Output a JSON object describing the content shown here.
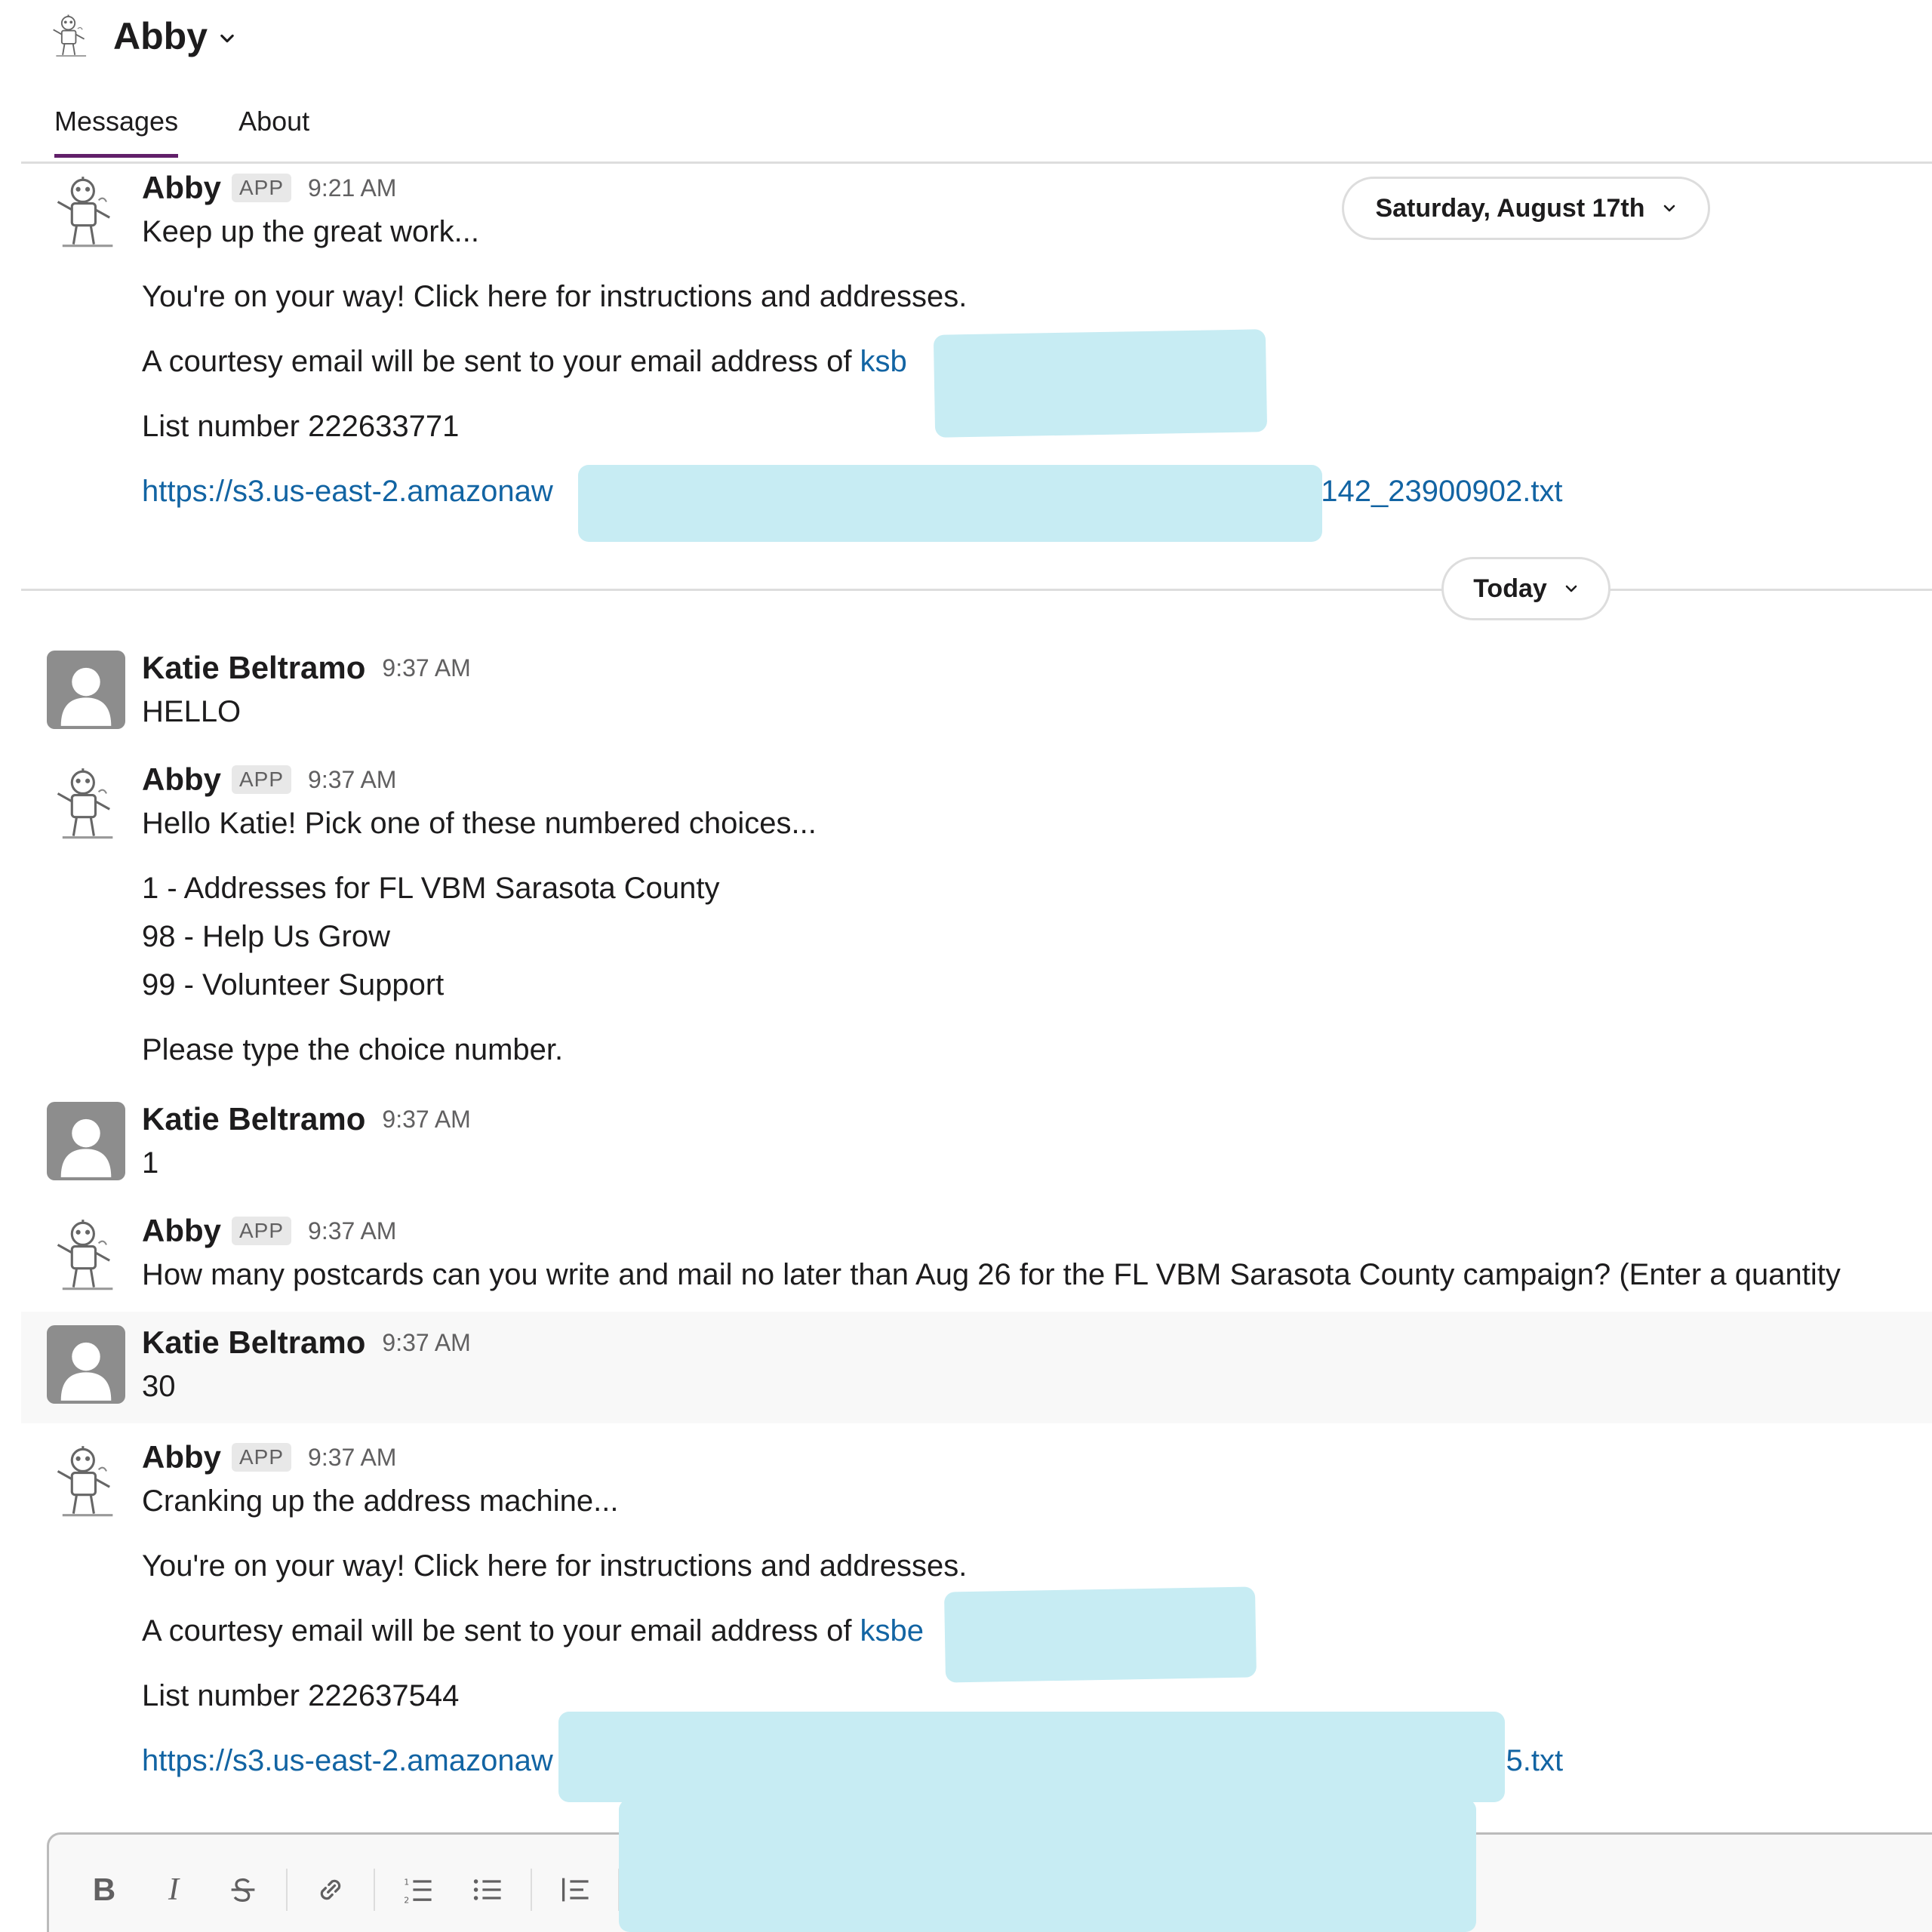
{
  "header": {
    "title": "Abby"
  },
  "tabs": [
    {
      "label": "Messages",
      "active": true
    },
    {
      "label": "About",
      "active": false
    }
  ],
  "date_pills": {
    "first": "Saturday, August 17th",
    "second": "Today"
  },
  "messages": [
    {
      "sender": "Abby",
      "badge": "APP",
      "time": "9:21 AM",
      "lines": [
        "Keep up the great work...",
        "You're on your way! Click here for instructions and addresses.",
        "A courtesy email will be sent to your email address of ",
        "List number 222633771"
      ],
      "email_partial": "ksb",
      "link_start": "https://s3.us-east-2.amazonaw",
      "link_end": "_142_23900902.txt"
    },
    {
      "sender": "Katie Beltramo",
      "time": "9:37 AM",
      "text": "HELLO"
    },
    {
      "sender": "Abby",
      "badge": "APP",
      "time": "9:37 AM",
      "lines": [
        "Hello Katie! Pick one of these numbered choices...",
        "1 - Addresses for FL VBM Sarasota County",
        "98 - Help Us Grow",
        "99 - Volunteer Support",
        "Please type the choice number."
      ]
    },
    {
      "sender": "Katie Beltramo",
      "time": "9:37 AM",
      "text": "1"
    },
    {
      "sender": "Abby",
      "badge": "APP",
      "time": "9:37 AM",
      "text": "How many postcards can you write and mail no later than Aug 26 for the FL VBM Sarasota County campaign? (Enter a quantity"
    },
    {
      "sender": "Katie Beltramo",
      "time": "9:37 AM",
      "text": "30"
    },
    {
      "sender": "Abby",
      "badge": "APP",
      "time": "9:37 AM",
      "lines": [
        "Cranking up the address machine...",
        "You're on your way! Click here for instructions and addresses.",
        "A courtesy email will be sent to your email address of ",
        "List number 222637544"
      ],
      "email_partial": "ksbe",
      "link_start": "https://s3.us-east-2.amazonaw",
      "link_end": "4420265.txt"
    }
  ],
  "composer": {
    "tools": [
      "B",
      "I"
    ]
  },
  "icons": {
    "bot_avatar": "robot-avatar-icon",
    "user_avatar": "person-avatar-icon",
    "chevron": "chevron-down-icon",
    "strike": "strikethrough-icon",
    "link": "link-icon",
    "ordered": "ordered-list-icon",
    "bullet": "bulleted-list-icon",
    "blockquote": "blockquote-icon"
  },
  "colors": {
    "link": "#1264a3",
    "tab_active": "#611f69",
    "redaction": "#c7ecf3"
  }
}
